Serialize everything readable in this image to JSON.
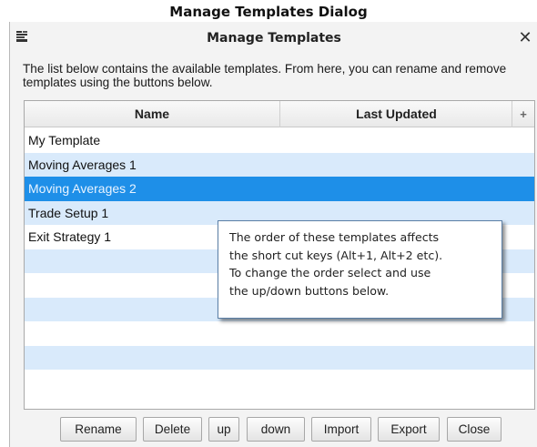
{
  "caption": "Manage Templates Dialog",
  "dialog": {
    "title": "Manage Templates",
    "close_glyph": "✕",
    "description": "The list below contains the available templates.  From here, you can rename and remove templates using the buttons below."
  },
  "table": {
    "columns": [
      "Name",
      "Last Updated"
    ],
    "add_column_glyph": "+",
    "rows": [
      {
        "name": "My Template",
        "last_updated": ""
      },
      {
        "name": "Moving Averages 1",
        "last_updated": ""
      },
      {
        "name": "Moving Averages 2",
        "last_updated": "",
        "selected": true
      },
      {
        "name": "Trade Setup 1",
        "last_updated": ""
      },
      {
        "name": "Exit Strategy 1",
        "last_updated": ""
      }
    ]
  },
  "tooltip": {
    "lines": [
      "The order of these templates affects",
      "the short cut keys (Alt+1, Alt+2 etc).",
      "To  change the order select and use",
      "the up/down buttons below."
    ]
  },
  "buttons": {
    "rename": "Rename",
    "delete": "Delete",
    "up": "up",
    "down": "down",
    "import": "Import",
    "export": "Export",
    "close": "Close"
  },
  "colors": {
    "selected_row": "#1e8fe8",
    "alt_row": "#d9eafb",
    "dialog_bg": "#f3f3f3"
  },
  "icons": {
    "app": "templates-app-icon",
    "close": "close-icon"
  }
}
